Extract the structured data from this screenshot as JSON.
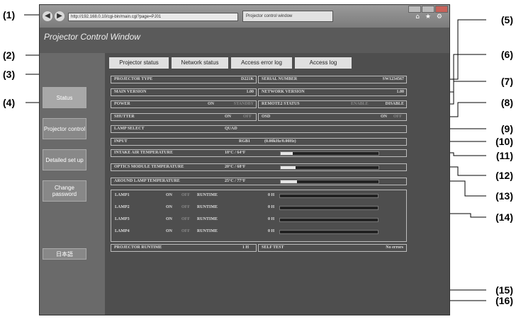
{
  "callouts": [
    "(1)",
    "(2)",
    "(3)",
    "(4)",
    "(5)",
    "(6)",
    "(7)",
    "(8)",
    "(9)",
    "(10)",
    "(11)",
    "(12)",
    "(13)",
    "(14)",
    "(15)",
    "(16)"
  ],
  "browser": {
    "address": "http://192.168.0.10/cgi-bin/main.cgi?page=PJ01",
    "tab_title": "Projector control window"
  },
  "app": {
    "title": "Projector Control Window"
  },
  "sidebar": {
    "status": "Status",
    "projector_control": "Projector control",
    "detailed_setup": "Detailed set up",
    "change_password": "Change password",
    "language": "日本語"
  },
  "tabs": {
    "projector_status": "Projector status",
    "network_status": "Network status",
    "access_error_log": "Access error log",
    "access_log": "Access log"
  },
  "status": {
    "projector_type_label": "PROJECTOR TYPE",
    "projector_type_value": "D221K",
    "serial_label": "SERIAL NUMBER",
    "serial_value": "SW1234567",
    "main_version_label": "MAIN VERSION",
    "main_version_value": "1.00",
    "network_version_label": "NETWORK VERSION",
    "network_version_value": "1.00",
    "power_label": "POWER",
    "on": "ON",
    "off": "OFF",
    "standby": "STANDBY",
    "remote2_label": "REMOTE2 STATUS",
    "enable": "ENABLE",
    "disable": "DISABLE",
    "shutter_label": "SHUTTER",
    "osd_label": "OSD",
    "lamp_select_label": "LAMP SELECT",
    "lamp_select_value": "QUAD",
    "input_label": "INPUT",
    "input_value": "RGB1",
    "input_freq": "(0.00kHz/0.00Hz)",
    "intake_label": "INTAKE AIR TEMPERATURE",
    "intake_value": "18°C / 64°F",
    "intake_level": 0.12,
    "optics_label": "OPTICS MODULE TEMPERATURE",
    "optics_value": "20°C / 68°F",
    "optics_level": 0.15,
    "lamp_temp_label": "AROUND LAMP TEMPERATURE",
    "lamp_temp_value": "25°C / 77°F",
    "lamp_temp_level": 0.17,
    "runtime_label": "RUNTIME",
    "lamps": [
      {
        "name": "LAMP1",
        "hours": "0 H"
      },
      {
        "name": "LAMP2",
        "hours": "0 H"
      },
      {
        "name": "LAMP3",
        "hours": "0 H"
      },
      {
        "name": "LAMP4",
        "hours": "0 H"
      }
    ],
    "projector_runtime_label": "PROJECTOR RUNTIME",
    "projector_runtime_value": "1 H",
    "self_test_label": "SELF TEST",
    "self_test_value": "No errors"
  }
}
